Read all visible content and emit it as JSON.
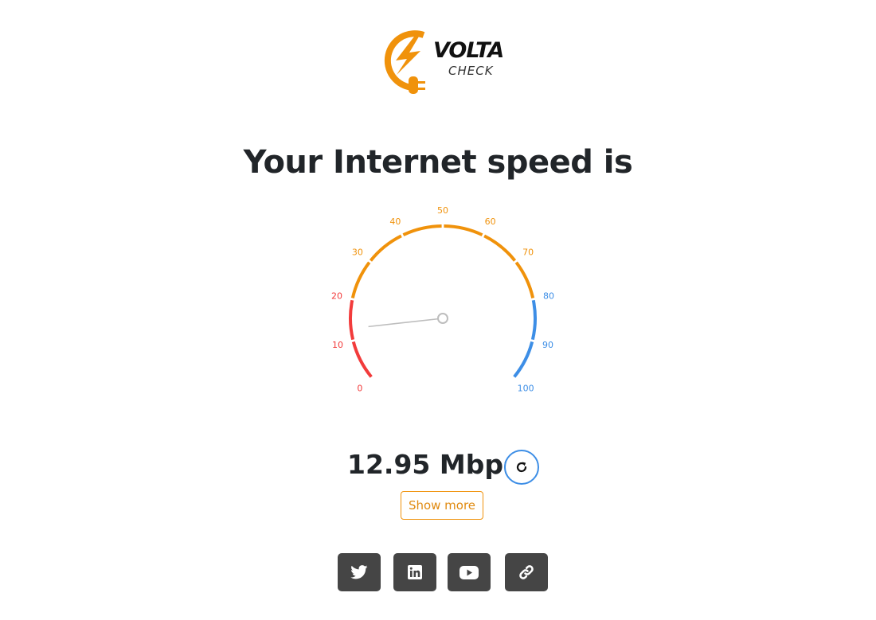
{
  "brand": {
    "name": "VOLTA",
    "subtitle": "CHECK",
    "accent_color": "#f0920b",
    "logo_icon": "lightning-plug-icon"
  },
  "heading": "Your Internet speed is",
  "gauge": {
    "min": 0,
    "max": 100,
    "value": 12.95,
    "ticks": [
      "0",
      "10",
      "20",
      "30",
      "40",
      "50",
      "60",
      "70",
      "80",
      "90",
      "100"
    ],
    "zones": [
      {
        "from": 0,
        "to": 20,
        "color": "#f23b3b"
      },
      {
        "from": 20,
        "to": 80,
        "color": "#f0920b"
      },
      {
        "from": 80,
        "to": 100,
        "color": "#3d8ee6"
      }
    ],
    "needle_color": "#bdbdbd"
  },
  "result": {
    "value": "12.95",
    "unit": "Mbps",
    "refresh_icon": "refresh-icon"
  },
  "show_more_label": "Show more",
  "socials": [
    {
      "icon": "twitter-icon"
    },
    {
      "icon": "linkedin-icon"
    },
    {
      "icon": "youtube-icon"
    },
    {
      "icon": "link-icon"
    }
  ]
}
